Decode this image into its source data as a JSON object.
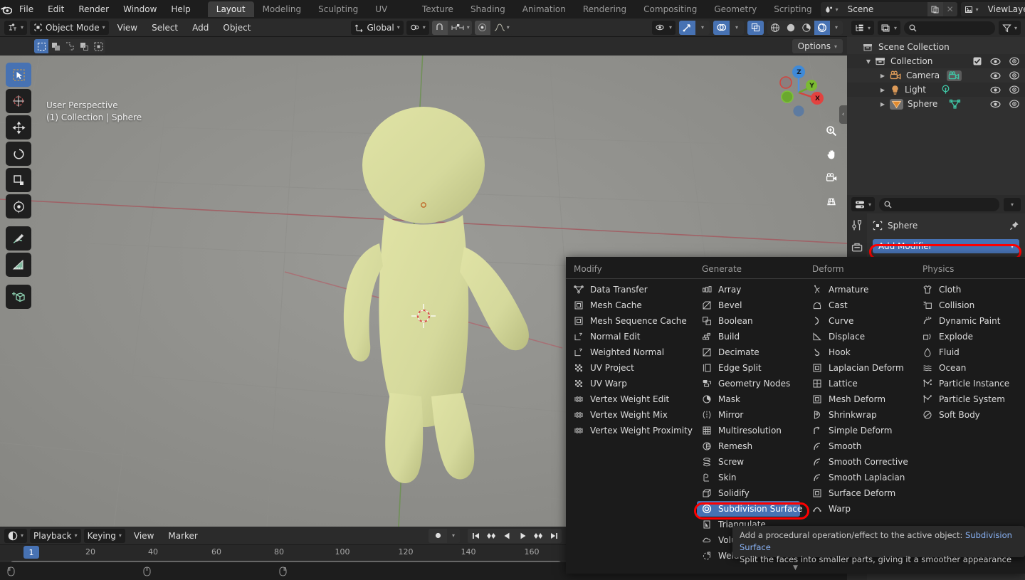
{
  "app": {
    "logo": "blender-logo"
  },
  "topbar": {
    "menus": [
      "File",
      "Edit",
      "Render",
      "Window",
      "Help"
    ],
    "workspaces": [
      {
        "label": "Layout",
        "active": true
      },
      {
        "label": "Modeling",
        "active": false
      },
      {
        "label": "Sculpting",
        "active": false
      },
      {
        "label": "UV Editing",
        "active": false
      },
      {
        "label": "Texture Paint",
        "active": false
      },
      {
        "label": "Shading",
        "active": false
      },
      {
        "label": "Animation",
        "active": false
      },
      {
        "label": "Rendering",
        "active": false
      },
      {
        "label": "Compositing",
        "active": false
      },
      {
        "label": "Geometry Nodes",
        "active": false
      },
      {
        "label": "Scripting",
        "active": false
      }
    ],
    "scene_field": {
      "value": "Scene",
      "icon": "scene-icon",
      "new_icon": "copy-icon",
      "close_icon": "x-icon"
    },
    "viewlayer_field": {
      "value": "ViewLayer",
      "icon": "viewlayer-icon",
      "new_icon": "copy-icon",
      "close_icon": "x-icon"
    }
  },
  "viewport_header": {
    "editor_type_icon": "editor-type-icon",
    "mode": "Object Mode",
    "mode_icon": "object-mode-icon",
    "menus": [
      "View",
      "Select",
      "Add",
      "Object"
    ],
    "transform_orientation": {
      "label": "Global",
      "icon": "orientation-icon"
    },
    "snap_icon": "snapping-magnet-icon",
    "proportional_icon": "proportional-edit-icon",
    "falloff_icon": "falloff-curve-icon",
    "pivot_icon": "pivot-point-icon",
    "visibility_icon": "eye-dropdown-icon",
    "gizmo_icon": "gizmo-icon",
    "overlays_icon": "overlays-icon",
    "xray_icon": "xray-icon",
    "shading_modes": [
      {
        "name": "wireframe-shading-icon",
        "active": false
      },
      {
        "name": "solid-shading-icon",
        "active": false
      },
      {
        "name": "material-preview-shading-icon",
        "active": false
      },
      {
        "name": "rendered-shading-icon",
        "active": true
      }
    ]
  },
  "viewport": {
    "select_modes": [
      {
        "name": "tweak-select-icon",
        "active": true
      },
      {
        "name": "box-select-icon",
        "active": false
      },
      {
        "name": "circle-select-icon",
        "active": false
      },
      {
        "name": "lasso-select-icon",
        "active": false
      },
      {
        "name": "select-all-icon",
        "active": false
      }
    ],
    "options_label": "Options",
    "overlay_line1": "User Perspective",
    "overlay_line2": "(1) Collection | Sphere",
    "toolbar": [
      {
        "name": "tool-tweak",
        "active": true
      },
      {
        "name": "tool-cursor",
        "active": false
      },
      {
        "name": "tool-move",
        "active": false
      },
      {
        "name": "tool-rotate",
        "active": false
      },
      {
        "name": "tool-scale",
        "active": false
      },
      {
        "name": "tool-transform",
        "active": false
      },
      {
        "name": "tool-annotate",
        "active": false
      },
      {
        "name": "tool-measure",
        "active": false
      },
      {
        "name": "tool-add-cube",
        "active": false
      }
    ],
    "nav_buttons": [
      "zoom-icon",
      "pan-hand-icon",
      "camera-view-icon",
      "ortho-persp-toggle-icon"
    ],
    "gizmo_axes": [
      {
        "label": "Z",
        "color": "#3f7fd4"
      },
      {
        "label": "Y",
        "color": "#70b437"
      },
      {
        "label": "X",
        "color": "#e0474c"
      }
    ]
  },
  "outliner": {
    "display_mode_icon": "outliner-display-mode-icon",
    "filter_id_icon": "outliner-id-type-icon",
    "search_placeholder": "",
    "search_icon": "search-icon",
    "filter_icon": "filter-funnel-icon",
    "rows": [
      {
        "label": "Scene Collection",
        "icon": "scene-collection-icon",
        "indent": 0,
        "expander": "",
        "checkbox": false,
        "eye": false,
        "camera": false
      },
      {
        "label": "Collection",
        "icon": "collection-icon",
        "indent": 1,
        "expander": "down",
        "checkbox": true,
        "eye": true,
        "camera": true
      },
      {
        "label": "Camera",
        "icon": "camera-object-icon",
        "indent": 2,
        "expander": "right",
        "data_icon": "camera-data-icon",
        "eye": true,
        "camera": true
      },
      {
        "label": "Light",
        "icon": "light-object-icon",
        "indent": 2,
        "expander": "right",
        "data_icon": "light-data-icon",
        "eye": true,
        "camera": true
      },
      {
        "label": "Sphere",
        "icon": "mesh-object-icon",
        "indent": 2,
        "expander": "right",
        "data_icon": "mesh-data-icon",
        "eye": true,
        "camera": true
      }
    ]
  },
  "properties": {
    "editor_icon": "properties-editor-icon",
    "search_icon": "search-icon",
    "dropdown_icon": "chevron-down-icon",
    "tabs": [
      "tool-tab-icon",
      "modifier-tab-icon"
    ],
    "breadcrumb_icon": "object-icon",
    "breadcrumb_label": "Sphere",
    "pin_icon": "pin-icon",
    "add_modifier_label": "Add Modifier",
    "add_modifier_chevron": "chevron-down-icon",
    "highlight_color": "#ff0000",
    "accent_color": "#4772b3"
  },
  "modifier_menu": {
    "columns": [
      {
        "title": "Modify",
        "items": [
          {
            "label": "Data Transfer",
            "icon": "mod-data-transfer-icon",
            "underline": 0
          },
          {
            "label": "Mesh Cache",
            "icon": "mod-mesh-cache-icon",
            "underline": 0
          },
          {
            "label": "Mesh Sequence Cache",
            "icon": "mod-mesh-sequence-cache-icon",
            "underline": 5
          },
          {
            "label": "Normal Edit",
            "icon": "mod-normal-edit-icon",
            "underline": 0
          },
          {
            "label": "Weighted Normal",
            "icon": "mod-weighted-normal-icon",
            "underline": 0
          },
          {
            "label": "UV Project",
            "icon": "mod-uv-project-icon",
            "underline": 3
          },
          {
            "label": "UV Warp",
            "icon": "mod-uv-warp-icon",
            "underline": -1
          },
          {
            "label": "Vertex Weight Edit",
            "icon": "mod-vertex-weight-edit-icon",
            "underline": 0
          },
          {
            "label": "Vertex Weight Mix",
            "icon": "mod-vertex-weight-mix-icon",
            "underline": 4
          },
          {
            "label": "Vertex Weight Proximity",
            "icon": "mod-vertex-weight-proximity-icon",
            "underline": 14
          }
        ]
      },
      {
        "title": "Generate",
        "items": [
          {
            "label": "Array",
            "icon": "mod-array-icon",
            "underline": 0
          },
          {
            "label": "Bevel",
            "icon": "mod-bevel-icon",
            "underline": 0
          },
          {
            "label": "Boolean",
            "icon": "mod-boolean-icon",
            "underline": -1
          },
          {
            "label": "Build",
            "icon": "mod-build-icon",
            "underline": -1
          },
          {
            "label": "Decimate",
            "icon": "mod-decimate-icon",
            "underline": -1
          },
          {
            "label": "Edge Split",
            "icon": "mod-edge-split-icon",
            "underline": 0
          },
          {
            "label": "Geometry Nodes",
            "icon": "mod-geometry-nodes-icon",
            "underline": 0
          },
          {
            "label": "Mask",
            "icon": "mod-mask-icon",
            "underline": 3
          },
          {
            "label": "Mirror",
            "icon": "mod-mirror-icon",
            "underline": -1
          },
          {
            "label": "Multiresolution",
            "icon": "mod-multiresolution-icon",
            "underline": -1
          },
          {
            "label": "Remesh",
            "icon": "mod-remesh-icon",
            "underline": 0
          },
          {
            "label": "Screw",
            "icon": "mod-screw-icon",
            "underline": -1
          },
          {
            "label": "Skin",
            "icon": "mod-skin-icon",
            "underline": -1
          },
          {
            "label": "Solidify",
            "icon": "mod-solidify-icon",
            "underline": -1
          },
          {
            "label": "Subdivision Surface",
            "icon": "mod-subdivision-surface-icon",
            "underline": -1,
            "selected": true
          },
          {
            "label": "Triangulate",
            "icon": "mod-triangulate-icon",
            "underline": 0
          },
          {
            "label": "Volume to Mesh",
            "icon": "mod-volume-to-mesh-icon",
            "underline": -1
          },
          {
            "label": "Weld",
            "icon": "mod-weld-icon",
            "underline": -1
          }
        ]
      },
      {
        "title": "Deform",
        "items": [
          {
            "label": "Armature",
            "icon": "mod-armature-icon",
            "underline": -1
          },
          {
            "label": "Cast",
            "icon": "mod-cast-icon",
            "underline": 0
          },
          {
            "label": "Curve",
            "icon": "mod-curve-icon",
            "underline": -1
          },
          {
            "label": "Displace",
            "icon": "mod-displace-icon",
            "underline": -1
          },
          {
            "label": "Hook",
            "icon": "mod-hook-icon",
            "underline": 0
          },
          {
            "label": "Laplacian Deform",
            "icon": "mod-laplacian-deform-icon",
            "underline": 0
          },
          {
            "label": "Lattice",
            "icon": "mod-lattice-icon",
            "underline": -1
          },
          {
            "label": "Mesh Deform",
            "icon": "mod-mesh-deform-icon",
            "underline": -1
          },
          {
            "label": "Shrinkwrap",
            "icon": "mod-shrinkwrap-icon",
            "underline": -1
          },
          {
            "label": "Simple Deform",
            "icon": "mod-simple-deform-icon",
            "underline": -1
          },
          {
            "label": "Smooth",
            "icon": "mod-smooth-icon",
            "underline": -1
          },
          {
            "label": "Smooth Corrective",
            "icon": "mod-smooth-corrective-icon",
            "underline": -1
          },
          {
            "label": "Smooth Laplacian",
            "icon": "mod-smooth-laplacian-icon",
            "underline": -1
          },
          {
            "label": "Surface Deform",
            "icon": "mod-surface-deform-icon",
            "underline": -1
          },
          {
            "label": "Warp",
            "icon": "mod-warp-icon",
            "underline": -1
          }
        ]
      },
      {
        "title": "Physics",
        "items": [
          {
            "label": "Cloth",
            "icon": "mod-cloth-icon",
            "underline": -1
          },
          {
            "label": "Collision",
            "icon": "mod-collision-icon",
            "underline": -1
          },
          {
            "label": "Dynamic Paint",
            "icon": "mod-dynamic-paint-icon",
            "underline": -1
          },
          {
            "label": "Explode",
            "icon": "mod-explode-icon",
            "underline": -1
          },
          {
            "label": "Fluid",
            "icon": "mod-fluid-icon",
            "underline": 0
          },
          {
            "label": "Ocean",
            "icon": "mod-ocean-icon",
            "underline": 0
          },
          {
            "label": "Particle Instance",
            "icon": "mod-particle-instance-icon",
            "underline": 9
          },
          {
            "label": "Particle System",
            "icon": "mod-particle-system-icon",
            "underline": -1
          },
          {
            "label": "Soft Body",
            "icon": "mod-soft-body-icon",
            "underline": -1
          }
        ]
      }
    ],
    "scroll_arrow": "scroll-down-arrow-icon"
  },
  "tooltip": {
    "line1_prefix": "Add a procedural operation/effect to the active object:",
    "line1_accent": "Subdivision Surface",
    "line2": "Split the faces into smaller parts, giving it a smoother appearance"
  },
  "timeline": {
    "editor_icon": "timeline-editor-icon",
    "menus": [
      {
        "label": "Playback",
        "dropdown": true
      },
      {
        "label": "Keying",
        "dropdown": true
      },
      {
        "label": "View",
        "dropdown": false
      },
      {
        "label": "Marker",
        "dropdown": false
      }
    ],
    "record_icon": "auto-keying-record-icon",
    "transport": [
      "jump-to-start-icon",
      "jump-prev-keyframe-icon",
      "play-reverse-icon",
      "play-icon",
      "jump-next-keyframe-icon",
      "jump-to-end-icon"
    ],
    "current_frame": "1",
    "ticks": [
      "20",
      "40",
      "60",
      "80",
      "100",
      "120",
      "140",
      "160"
    ],
    "tick_positions": [
      127,
      260,
      393,
      526,
      659,
      792,
      925,
      1058
    ]
  }
}
